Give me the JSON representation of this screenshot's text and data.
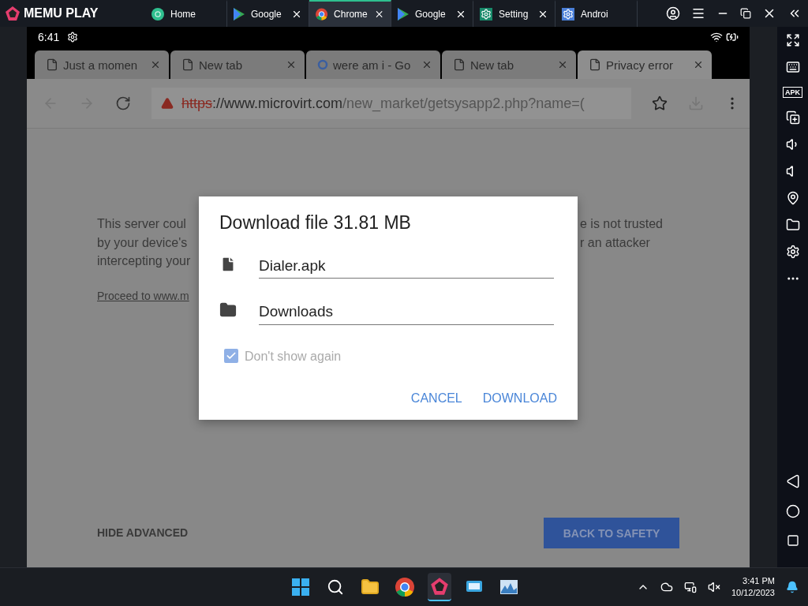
{
  "emulator": {
    "logo": "MEMU PLAY",
    "tabs": [
      {
        "label": "Home",
        "kind": "home",
        "selected": false,
        "closable": false
      },
      {
        "label": "Google",
        "kind": "play",
        "selected": false,
        "closable": true
      },
      {
        "label": "Chrome",
        "kind": "chrome",
        "selected": true,
        "closable": true
      },
      {
        "label": "Google",
        "kind": "play",
        "selected": false,
        "closable": true
      },
      {
        "label": "Setting",
        "kind": "settings",
        "selected": false,
        "closable": true
      },
      {
        "label": "Androi",
        "kind": "android",
        "selected": false,
        "closable": false
      }
    ],
    "sidebar_apk": "APK"
  },
  "android": {
    "time": "6:41",
    "browser_tabs": [
      {
        "label": "Just a momen",
        "kind": "page",
        "selected": false
      },
      {
        "label": "New tab",
        "kind": "page",
        "selected": false
      },
      {
        "label": "were am i - Go",
        "kind": "google",
        "selected": false
      },
      {
        "label": "New tab",
        "kind": "page",
        "selected": false
      },
      {
        "label": "Privacy error",
        "kind": "page",
        "selected": true
      }
    ],
    "url": {
      "scheme": "https",
      "host": "://www.microvirt.com",
      "path": "/new_market/getsysapp2.php?name=("
    },
    "page": {
      "left_lines": [
        "This server coul",
        "by your device's",
        "intercepting your"
      ],
      "right_lines": [
        "e is not trusted",
        "r an attacker"
      ],
      "link": "Proceed to www.m",
      "hide_advanced": "HIDE ADVANCED",
      "back_button": "BACK TO SAFETY"
    },
    "dialog": {
      "title": "Download file 31.81 MB",
      "file_name": "Dialer.apk",
      "folder": "Downloads",
      "checkbox_label": "Don't show again",
      "checked": true,
      "cancel": "CANCEL",
      "confirm": "DOWNLOAD"
    }
  },
  "taskbar": {
    "time": "3:41 PM",
    "date": "10/12/2023"
  }
}
